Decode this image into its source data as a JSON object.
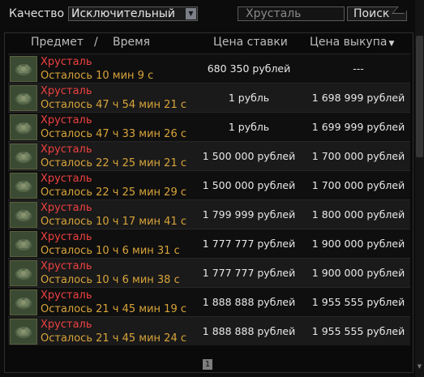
{
  "filters": {
    "quality_label": "Качество",
    "quality_value": "Исключительный",
    "search_value": "Хрусталь",
    "search_button": "Поиск"
  },
  "table": {
    "headers": {
      "item": "Предмет",
      "separator": "/",
      "time": "Время",
      "bid": "Цена ставки",
      "buyout": "Цена выкупа"
    },
    "rows": [
      {
        "name": "Хрусталь",
        "time_left": "Осталось 10 мин 9 с",
        "bid": "680 350 рублей",
        "buyout": "---"
      },
      {
        "name": "Хрусталь",
        "time_left": "Осталось 47 ч 54 мин 21 с",
        "bid": "1 рубль",
        "buyout": "1 698 999 рублей"
      },
      {
        "name": "Хрусталь",
        "time_left": "Осталось 47 ч 33 мин 26 с",
        "bid": "1 рубль",
        "buyout": "1 699 999 рублей"
      },
      {
        "name": "Хрусталь",
        "time_left": "Осталось 22 ч 25 мин 21 с",
        "bid": "1 500 000 рублей",
        "buyout": "1 700 000 рублей"
      },
      {
        "name": "Хрусталь",
        "time_left": "Осталось 22 ч 25 мин 29 с",
        "bid": "1 500 000 рублей",
        "buyout": "1 700 000 рублей"
      },
      {
        "name": "Хрусталь",
        "time_left": "Осталось 10 ч 17 мин 41 с",
        "bid": "1 799 999 рублей",
        "buyout": "1 800 000 рублей"
      },
      {
        "name": "Хрусталь",
        "time_left": "Осталось 10 ч 6 мин 31 с",
        "bid": "1 777 777 рублей",
        "buyout": "1 900 000 рублей"
      },
      {
        "name": "Хрусталь",
        "time_left": "Осталось 10 ч 6 мин 38 с",
        "bid": "1 777 777 рублей",
        "buyout": "1 900 000 рублей"
      },
      {
        "name": "Хрусталь",
        "time_left": "Осталось 21 ч 45 мин 19 с",
        "bid": "1 888 888 рублей",
        "buyout": "1 955 555 рублей"
      },
      {
        "name": "Хрусталь",
        "time_left": "Осталось 21 ч 45 мин 24 с",
        "bid": "1 888 888 рублей",
        "buyout": "1 955 555 рублей"
      }
    ]
  },
  "pagination": {
    "current_page": "1"
  },
  "icons": {
    "select_arrow": "dropdown-arrow-icon",
    "sort": "sort-desc-icon",
    "item": "crystal-item-icon"
  },
  "colors": {
    "item_name": "#ef4040",
    "time_left": "#d8a43a",
    "background": "#0c0c0c"
  }
}
